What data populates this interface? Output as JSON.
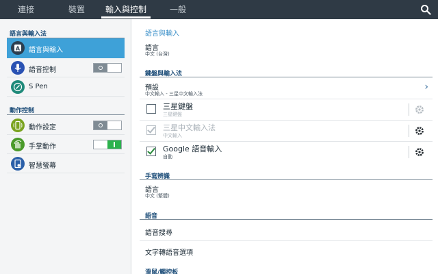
{
  "tabs": [
    {
      "label": "連接"
    },
    {
      "label": "裝置"
    },
    {
      "label": "輸入與控制",
      "active": true
    },
    {
      "label": "一般"
    }
  ],
  "sidebar": {
    "section1_title": "語言與輸入法",
    "section2_title": "動作控制",
    "items": [
      {
        "label": "語言與輸入",
        "icon": "keyboard-a-icon",
        "selected": true
      },
      {
        "label": "語音控制",
        "icon": "microphone-icon",
        "toggle": "off"
      },
      {
        "label": "S Pen",
        "icon": "pen-icon"
      },
      {
        "label": "動作設定",
        "icon": "phone-motion-icon",
        "toggle": "off"
      },
      {
        "label": "手掌動作",
        "icon": "palm-motion-icon",
        "toggle": "on"
      },
      {
        "label": "智慧螢幕",
        "icon": "smart-screen-icon"
      }
    ]
  },
  "main": {
    "title": "語言與輸入",
    "language": {
      "label": "語言",
      "value": "中文 (台灣)"
    },
    "keyboards_head": "鍵盤與輸入法",
    "default": {
      "label": "預設",
      "value": "中文輸入 - 三星中文輸入法"
    },
    "keyboards": [
      {
        "name": "三星鍵盤",
        "sub": "三星鍵盤",
        "checked": false,
        "dim_sub": true
      },
      {
        "name": "三星中文輸入法",
        "sub": "中文輸入",
        "checked": true,
        "dim": true
      },
      {
        "name": "Google 語音輸入",
        "sub": "自動",
        "checked": true
      }
    ],
    "handwriting_head": "手寫辨識",
    "handwriting_language": {
      "label": "語言",
      "value": "中文 (繁體)"
    },
    "voice_head": "語音",
    "voice_items": [
      "語音搜尋",
      "文字轉語音選項"
    ],
    "mouse_head": "滑鼠/觸控板"
  },
  "colors": {
    "topbar": "#2f3a45",
    "accent": "#3ea1d8",
    "header_text": "#1f4f7a"
  }
}
